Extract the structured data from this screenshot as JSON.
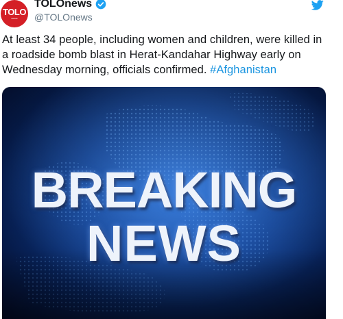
{
  "account": {
    "display_name": "TOLOnews",
    "handle": "@TOLOnews",
    "avatar_text": "TOLO",
    "avatar_subtext": "news",
    "verified": true
  },
  "icons": {
    "verified": "verified-badge-icon",
    "platform": "twitter-bird-icon"
  },
  "tweet": {
    "text": "At least 34 people, including women and children, were killed in a roadside bomb blast in Herat-Kandahar Highway early on Wednesday morning, officials confirmed. ",
    "hashtag": "#Afghanistan"
  },
  "media": {
    "headline_line1": "BREAKING",
    "headline_line2": "NEWS"
  },
  "colors": {
    "brand_red": "#d41f26",
    "twitter_blue": "#1da1f2",
    "hashtag_blue": "#1b95e0",
    "media_blue": "#0d3a8a"
  }
}
